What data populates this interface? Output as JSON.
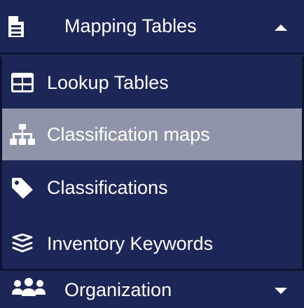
{
  "header": {
    "title": "Mapping Tables",
    "icon": "file-icon",
    "chevron": "chevron-up-icon"
  },
  "items": [
    {
      "label": "Lookup Tables",
      "icon": "table-icon",
      "active": false
    },
    {
      "label": "Classification maps",
      "icon": "sitemap-icon",
      "active": true
    },
    {
      "label": "Classifications",
      "icon": "tag-icon",
      "active": false
    },
    {
      "label": "Inventory Keywords",
      "icon": "layers-icon",
      "active": false
    }
  ],
  "footer": {
    "title": "Organization",
    "icon": "users-icon",
    "chevron": "chevron-down-icon"
  },
  "colors": {
    "background": "#1d2757",
    "active": "#8e95a8",
    "border": "#0e1431",
    "text": "#ffffff"
  }
}
